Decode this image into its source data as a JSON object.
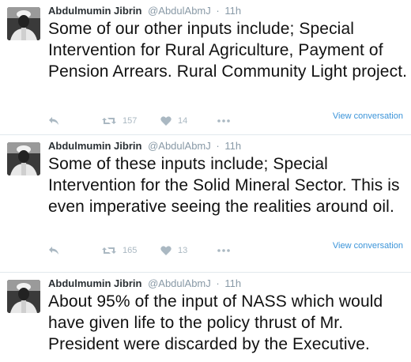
{
  "tweets": [
    {
      "name": "Abdulmumin Jibrin",
      "handle": "@AbdulAbmJ",
      "separator": "·",
      "time": "11h",
      "text": "Some of our other inputs include; Special Intervention for Rural Agriculture, Payment of Pension Arrears. Rural Community Light project.",
      "retweets": "157",
      "likes": "14",
      "view_conversation": "View conversation"
    },
    {
      "name": "Abdulmumin Jibrin",
      "handle": "@AbdulAbmJ",
      "separator": "·",
      "time": "11h",
      "text": "Some of these inputs include; Special Intervention for the Solid Mineral Sector. This is even imperative seeing the realities around oil.",
      "retweets": "165",
      "likes": "13",
      "view_conversation": "View conversation"
    },
    {
      "name": "Abdulmumin Jibrin",
      "handle": "@AbdulAbmJ",
      "separator": "·",
      "time": "11h",
      "text": "About 95% of the input of NASS which would have given life to the policy thrust of Mr. President were discarded by the Executive."
    }
  ],
  "icons": {
    "reply": "reply-icon",
    "retweet": "retweet-icon",
    "like": "heart-icon",
    "more": "more-icon"
  },
  "colors": {
    "link": "#3b94d9",
    "muted": "#8899a6",
    "icon": "#aab8c2",
    "divider": "#e1e8ed"
  }
}
